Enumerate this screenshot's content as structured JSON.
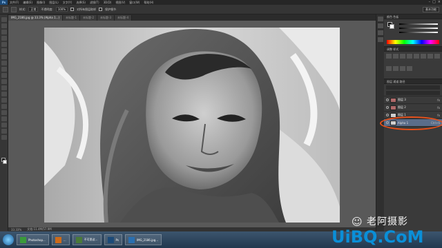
{
  "app": {
    "name": "Ps",
    "menus": [
      "文件(F)",
      "编辑(E)",
      "图像(I)",
      "图层(L)",
      "文字(Y)",
      "选择(S)",
      "滤镜(T)",
      "3D(D)",
      "视图(V)",
      "窗口(W)",
      "帮助(H)"
    ],
    "window_controls": [
      "–",
      "□",
      "×"
    ]
  },
  "options": {
    "mode_label": "样式:",
    "mode_value": "正常",
    "opacity_label": "不透明度:",
    "opacity_value": "100%",
    "checkbox1_label": "对所有图层取样",
    "checkbox2_label": "保护细节",
    "workspace": "基本功能"
  },
  "tabs": [
    {
      "label": "IMG_2186.jpg @ 33.3% (Alpha 1...)"
    },
    {
      "label": "未标题-1"
    },
    {
      "label": "未标题-2"
    },
    {
      "label": "未标题-3"
    },
    {
      "label": "未标题-4"
    }
  ],
  "status": {
    "zoom": "33.33%",
    "doc": "文档:11.4M/57.9M"
  },
  "panels": {
    "color_title": "颜色  色板",
    "adjust_title": "调整  样式",
    "layers_title": "图层  通道  路径",
    "layers": [
      {
        "name": "图层 3",
        "opt": "fx"
      },
      {
        "name": "图层 2",
        "opt": "fx"
      },
      {
        "name": "图层 1",
        "opt": "fx"
      },
      {
        "name": "Alpha 1",
        "opt": "Ctrl+6",
        "selected": true
      }
    ]
  },
  "taskbar": {
    "items": [
      {
        "label": "Photoshop...",
        "color": "#3a9a3a"
      },
      {
        "label": "...",
        "color": "#cc6a1a"
      },
      {
        "label": "不可思议...",
        "color": "#4a7a3a"
      },
      {
        "label": "Ps",
        "color": "#1c4a78"
      },
      {
        "label": "IMG_2186.jpg...",
        "color": "#2a6fb0"
      }
    ]
  },
  "watermark": {
    "icon": "wechat-icon",
    "author": "老阿摄影",
    "site": "UiBQ.CoM"
  },
  "colors": {
    "highlight_ring": "#e8501a",
    "selected_layer": "#5a6d8a",
    "site_blue": "#0a8fd8"
  }
}
